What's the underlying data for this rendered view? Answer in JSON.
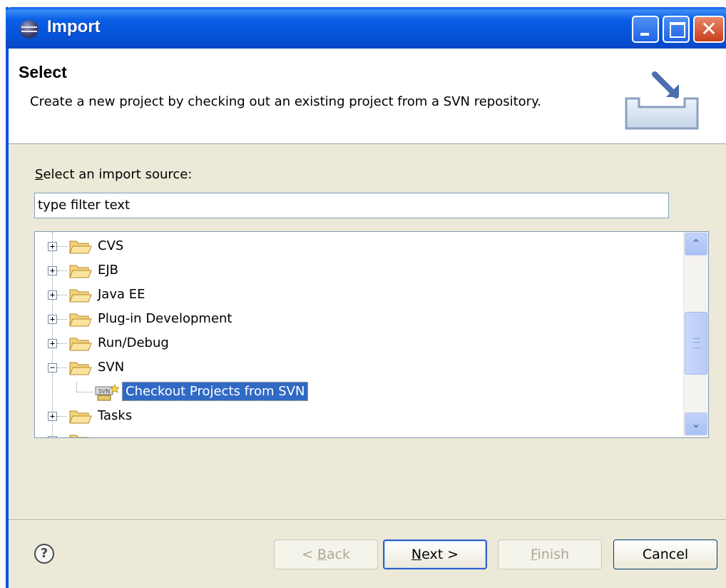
{
  "window": {
    "title": "Import",
    "title_icon": "eclipse-icon",
    "controls": [
      "minimize",
      "maximize",
      "close"
    ]
  },
  "header": {
    "title": "Select",
    "description": "Create a new project by checking out an existing project from a SVN repository."
  },
  "source": {
    "label": "Select an import source:",
    "filter_value": "type filter text"
  },
  "tree": {
    "items": [
      {
        "label": "CVS",
        "expanded": false
      },
      {
        "label": "EJB",
        "expanded": false
      },
      {
        "label": "Java EE",
        "expanded": false
      },
      {
        "label": "Plug-in Development",
        "expanded": false
      },
      {
        "label": "Run/Debug",
        "expanded": false
      },
      {
        "label": "SVN",
        "expanded": true
      },
      {
        "label": "Checkout Projects from SVN",
        "child": true,
        "selected": true
      },
      {
        "label": "Tasks",
        "expanded": false
      }
    ]
  },
  "buttons": {
    "back": {
      "pre": "< ",
      "mnemonic": "B",
      "post": "ack",
      "enabled": false
    },
    "next": {
      "mnemonic": "N",
      "post": "ext >",
      "enabled": true
    },
    "finish": {
      "mnemonic": "F",
      "post": "inish",
      "enabled": false
    },
    "cancel": {
      "label": "Cancel",
      "enabled": true
    }
  },
  "colors": {
    "title_bar": "#0a5ee6",
    "selection": "#316ac5",
    "dialog_bg": "#ece9d8"
  }
}
